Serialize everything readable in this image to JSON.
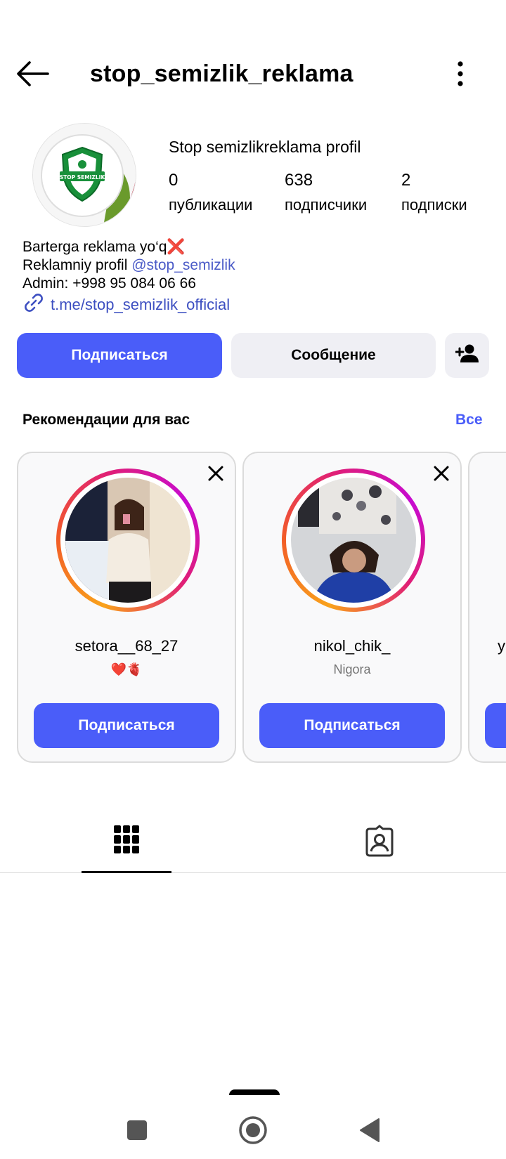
{
  "header": {
    "title": "stop_semizlik_reklama"
  },
  "profile": {
    "avatar_text": "STOP SEMIZLIK",
    "display_name": "Stop semizlikreklama profil",
    "stats": [
      {
        "value": "0",
        "label": "публикации"
      },
      {
        "value": "638",
        "label": "подписчики"
      },
      {
        "value": "2",
        "label": "подписки"
      }
    ],
    "bio": {
      "line1": "Barterga reklama yo‘q❌",
      "line2_prefix": "Reklamniy profil ",
      "line2_mention": "@stop_semizlik",
      "line3": "Admin: +998 95 084 06 66"
    },
    "link": "t.me/stop_semizlik_official"
  },
  "actions": {
    "follow": "Подписаться",
    "message": "Сообщение"
  },
  "recommendations": {
    "title": "Рекомендации для вас",
    "see_all": "Все",
    "cards": [
      {
        "username": "setora__68_27",
        "subtitle": "❤️🫀",
        "button": "Подписаться"
      },
      {
        "username": "nikol_chik_",
        "subtitle": "Nigora",
        "button": "Подписаться"
      },
      {
        "username": "y"
      }
    ]
  },
  "colors": {
    "primary": "#4a5df9",
    "link": "#3d4fc1",
    "secondary_button": "#efeff4",
    "muted_text": "#737373"
  }
}
